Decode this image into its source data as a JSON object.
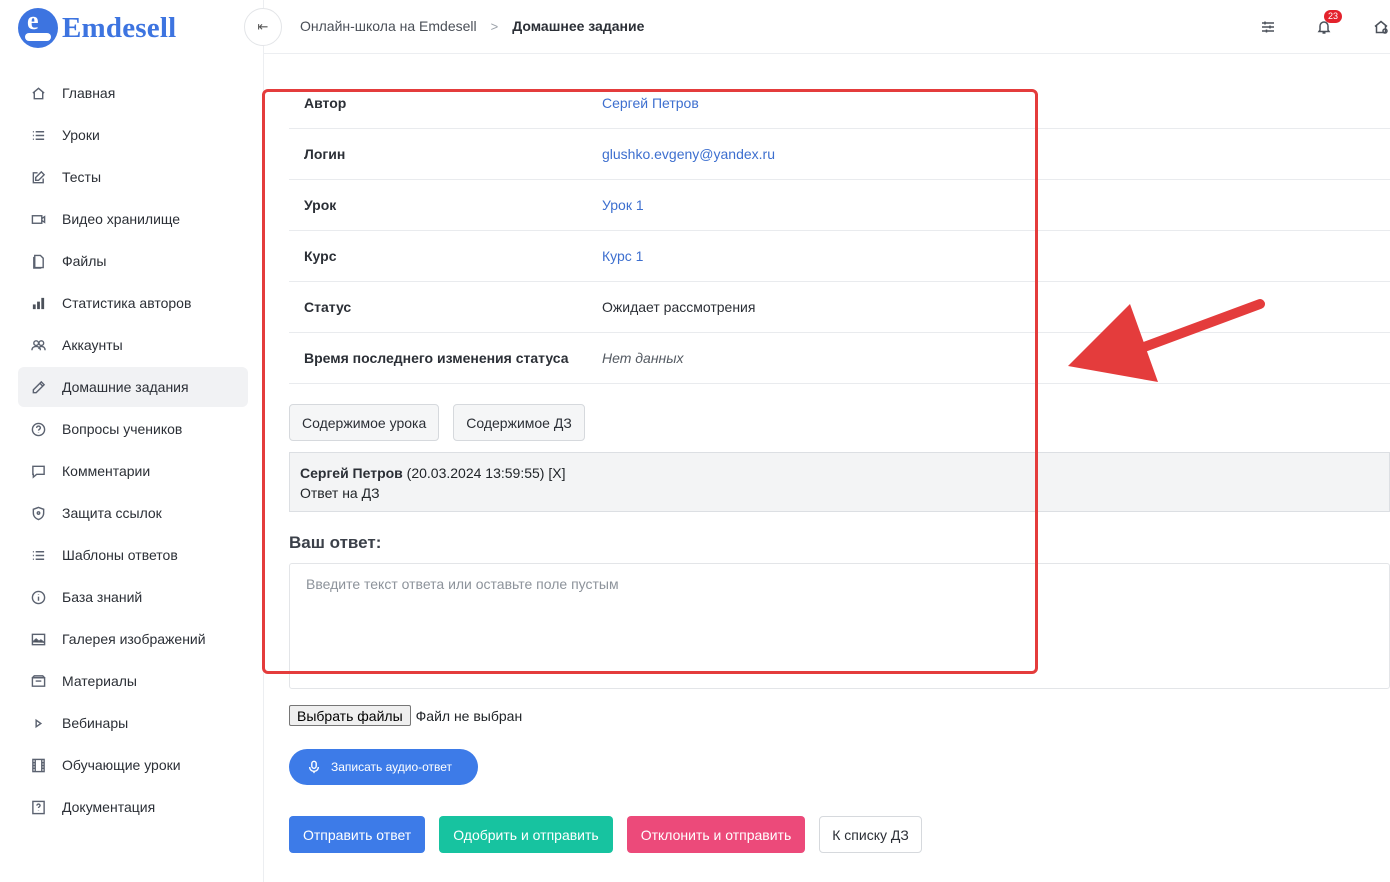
{
  "brand": {
    "name": "Emdesell",
    "logo_letter": "e",
    "color": "#3d74e0"
  },
  "sidebar": {
    "items": [
      {
        "label": "Главная",
        "icon": "home-icon"
      },
      {
        "label": "Уроки",
        "icon": "list-icon"
      },
      {
        "label": "Тесты",
        "icon": "edit-icon"
      },
      {
        "label": "Видео хранилище",
        "icon": "video-icon"
      },
      {
        "label": "Файлы",
        "icon": "file-icon"
      },
      {
        "label": "Статистика авторов",
        "icon": "bar-chart-icon"
      },
      {
        "label": "Аккаунты",
        "icon": "users-icon"
      },
      {
        "label": "Домашние задания",
        "icon": "pencil-icon",
        "active": true
      },
      {
        "label": "Вопросы учеников",
        "icon": "help-circle-icon"
      },
      {
        "label": "Комментарии",
        "icon": "comment-icon"
      },
      {
        "label": "Защита ссылок",
        "icon": "shield-icon"
      },
      {
        "label": "Шаблоны ответов",
        "icon": "list-icon"
      },
      {
        "label": "База знаний",
        "icon": "info-icon"
      },
      {
        "label": "Галерея изображений",
        "icon": "image-icon"
      },
      {
        "label": "Материалы",
        "icon": "folder-icon"
      },
      {
        "label": "Вебинары",
        "icon": "play-icon"
      },
      {
        "label": "Обучающие уроки",
        "icon": "film-icon"
      },
      {
        "label": "Документация",
        "icon": "question-box-icon"
      }
    ]
  },
  "header": {
    "breadcrumb": {
      "parent": "Онлайн-школа на Emdesell",
      "current": "Домашнее задание"
    },
    "notifications_count": "23"
  },
  "details": {
    "rows": [
      {
        "label": "Автор",
        "value": "Сергей Петров",
        "style": "link"
      },
      {
        "label": "Логин",
        "value": "glushko.evgeny@yandex.ru",
        "style": "link"
      },
      {
        "label": "Урок",
        "value": "Урок 1",
        "style": "link"
      },
      {
        "label": "Курс",
        "value": "Курс 1",
        "style": "link"
      },
      {
        "label": "Статус",
        "value": "Ожидает рассмотрения",
        "style": "plain"
      },
      {
        "label": "Время последнего изменения статуса",
        "value": "Нет данных",
        "style": "italic"
      }
    ]
  },
  "content_buttons": {
    "lesson": "Содержимое урока",
    "homework": "Содержимое ДЗ"
  },
  "message": {
    "author": "Сергей Петров",
    "meta": " (20.03.2024 13:59:55) [X]",
    "text": "Ответ на ДЗ"
  },
  "answer": {
    "title": "Ваш ответ:",
    "placeholder": "Введите текст ответа или оставьте поле пустым"
  },
  "file_input": {
    "button": "Выбрать файлы",
    "status": "Файл не выбран"
  },
  "audio_button": "Записать аудио-ответ",
  "actions": {
    "send": "Отправить ответ",
    "approve": "Одобрить и отправить",
    "reject": "Отклонить и отправить",
    "back": "К списку ДЗ"
  },
  "colors": {
    "primary": "#3d7be8",
    "success": "#17c3a0",
    "danger": "#ec4a7a",
    "annotation": "#e43c3c"
  }
}
